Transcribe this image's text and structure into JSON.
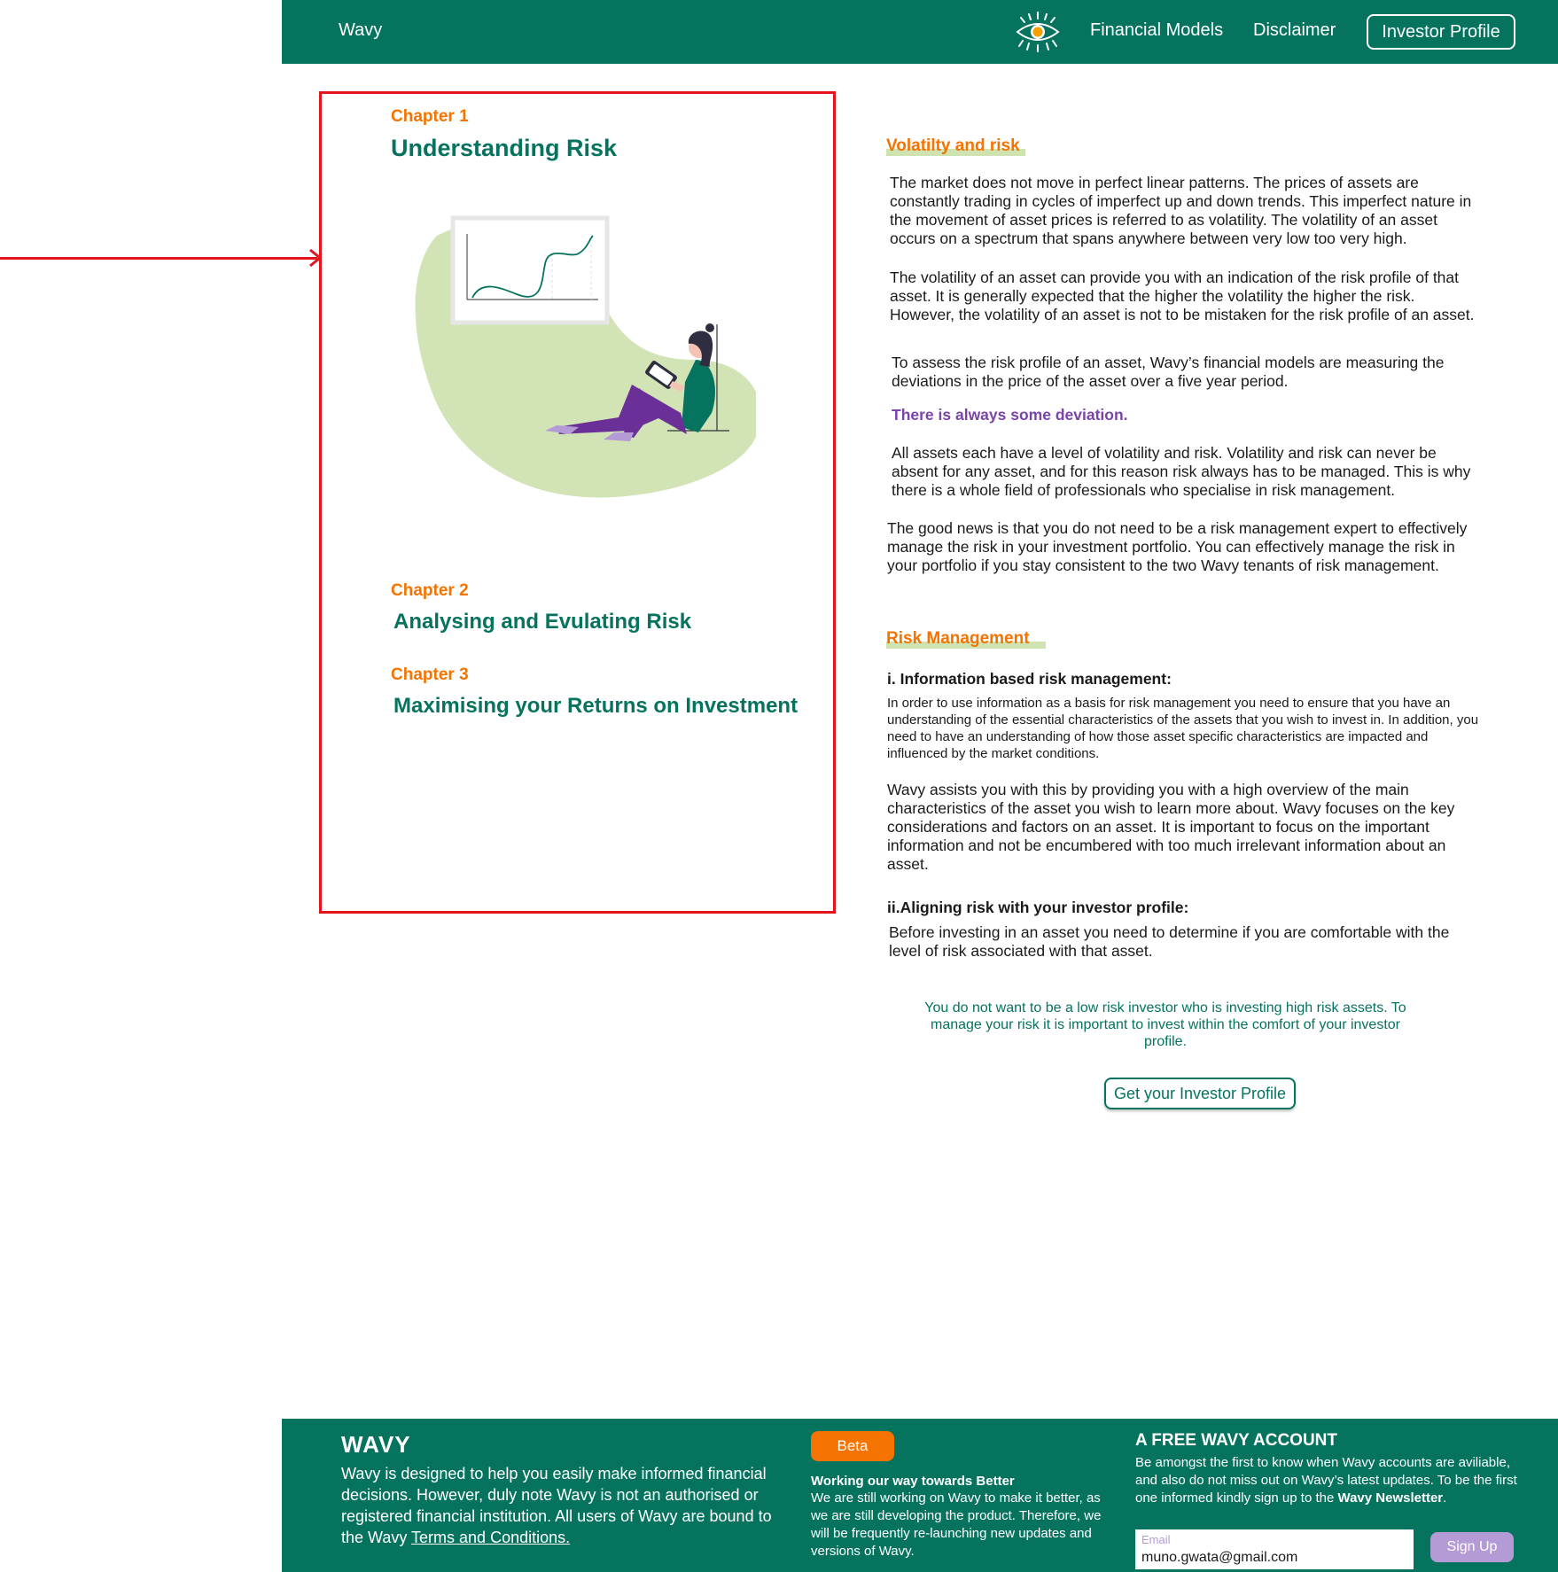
{
  "header": {
    "brand": "Wavy",
    "nav": {
      "financial_models": "Financial Models",
      "disclaimer": "Disclaimer",
      "investor_profile": "Investor Profile"
    }
  },
  "chapters": [
    {
      "kicker": "Chapter 1",
      "title": "Understanding Risk"
    },
    {
      "kicker": "Chapter 2",
      "title": "Analysing and Evulating Risk"
    },
    {
      "kicker": "Chapter 3",
      "title": "Maximising your Returns on Investment"
    }
  ],
  "article": {
    "volatility_heading": "Volatilty and risk",
    "p1": "The market does not move in perfect linear patterns. The prices of assets are constantly trading in cycles of imperfect up and down trends. This imperfect nature in the movement of asset prices is referred to as volatility. The volatility of an asset occurs on a spectrum that spans anywhere between very low too very high.",
    "p2": "The volatility of an asset can provide you with an indication of the risk profile of that asset. It is generally expected that the higher the volatility the higher the risk. However, the volatility of an asset is not to be mistaken for the risk profile of an asset.",
    "p3": "To assess the risk profile of an asset, Wavy’s financial models are measuring the deviations in the price of the asset over a five year period.",
    "callout": "There is always some deviation.",
    "p4": "All assets each have a level of volatility and risk. Volatility and risk can never be absent for any asset, and for this reason risk always has to be managed. This is why there is a whole field of professionals who specialise in risk management.",
    "p5": "The good news is that you do not need to be a risk management expert to effectively manage the risk in your investment portfolio. You can effectively manage the risk in your portfolio if you stay consistent to the two Wavy tenants of risk management.",
    "risk_heading": "Risk Management",
    "sub1": "i. Information based risk management:",
    "p6": "In order to use information as a basis for risk management you need to ensure that you have an understanding of the essential characteristics of the assets that you wish to invest in. In addition, you need to have an understanding of how those asset specific characteristics are impacted and influenced by the market conditions.",
    "p7": "Wavy assists you with this by providing you with a high overview of the main characteristics of the asset you wish to learn more about. Wavy focuses on the key considerations and factors on an asset. It is important to focus on the important information and not be encumbered with too much irrelevant information about an asset.",
    "sub2": "ii.Aligning risk with your investor profile:",
    "p8": "Before investing in an asset you need to determine if you are comfortable with the level of risk associated with that asset.",
    "quote": "You do not want to be a low risk investor who is investing high risk assets. To manage your risk it is important to invest within the comfort of your investor profile.",
    "cta": "Get your Investor Profile"
  },
  "footer": {
    "logo": "WAVY",
    "desc": "Wavy is designed to help you easily make informed financial decisions. However, duly note Wavy is not an authorised or registered financial institution. All users of Wavy are bound to the Wavy ",
    "terms": "Terms and Conditions.",
    "beta": "Beta",
    "work_title": "Working our way towards Better",
    "work_text": "We are still working on Wavy to make it better, as we are still developing the product. Therefore, we will be frequently re-launching new updates and versions of Wavy.",
    "account_title": "A FREE WAVY ACCOUNT",
    "account_text": "Be amongst the first to know when Wavy accounts are aviliable, and also do not miss out on Wavy’s latest updates. To be the first one informed kindly sign up to the ",
    "account_bold": "Wavy Newsletter",
    "account_end": ".",
    "email_label": "Email",
    "email_value": "muno.gwata@gmail.com",
    "signup": "Sign Up"
  },
  "colors": {
    "brand_green": "#06735f",
    "accent_orange": "#f57300",
    "callout_purple": "#7a44a8",
    "annotation_red": "#e3141b",
    "highlight_green": "#cfe3b0"
  },
  "icons": [
    "eye-icon",
    "arrow-icon"
  ]
}
